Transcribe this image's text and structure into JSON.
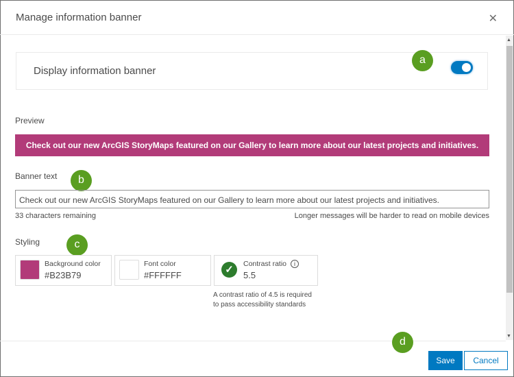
{
  "dialog": {
    "title": "Manage information banner",
    "close_icon": "close-icon"
  },
  "display": {
    "label": "Display information banner",
    "enabled": true
  },
  "preview": {
    "label": "Preview",
    "text": "Check out our new ArcGIS StoryMaps featured on our Gallery to learn more about our latest projects and initiatives.",
    "background": "#B23B79",
    "font_color": "#FFFFFF"
  },
  "banner_text": {
    "label": "Banner text",
    "value": "Check out our new ArcGIS StoryMaps featured on our Gallery to learn more about our latest projects and initiatives.",
    "remaining": "33 characters remaining",
    "hint": "Longer messages will be harder to read on mobile devices"
  },
  "styling": {
    "label": "Styling",
    "background": {
      "label": "Background color",
      "value": "#B23B79"
    },
    "font": {
      "label": "Font color",
      "value": "#FFFFFF"
    },
    "contrast": {
      "label": "Contrast ratio",
      "value": "5.5",
      "note1": "A contrast ratio of 4.5 is required",
      "note2": "to pass accessibility standards"
    }
  },
  "callouts": [
    "a",
    "b",
    "c",
    "d"
  ],
  "footer": {
    "save": "Save",
    "cancel": "Cancel"
  }
}
